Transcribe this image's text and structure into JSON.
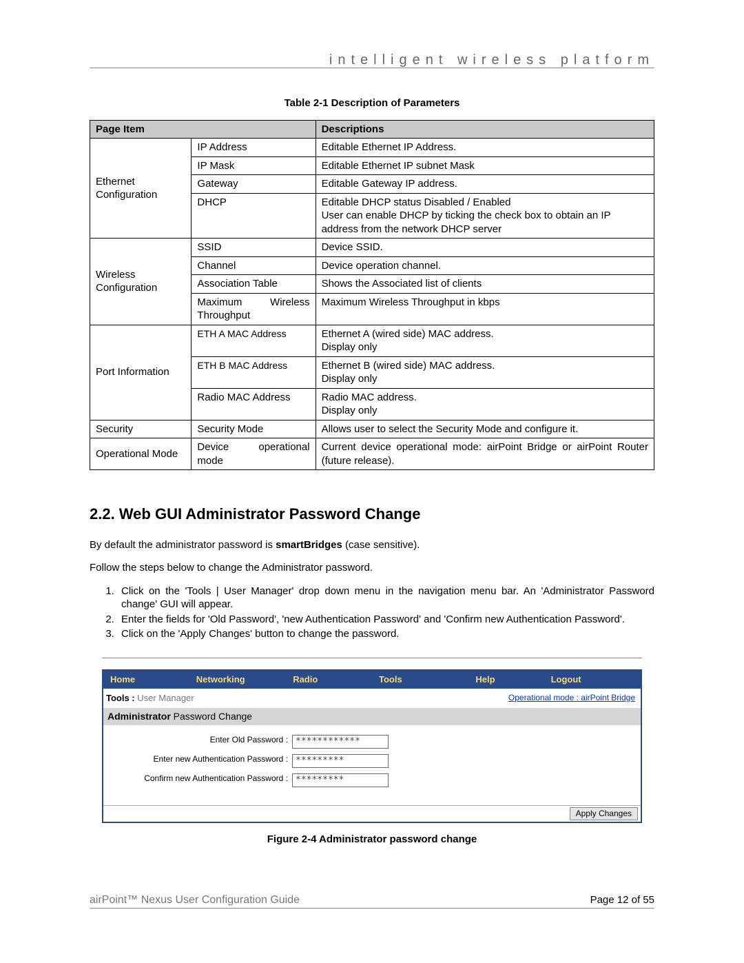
{
  "header_tagline": "intelligent wireless platform",
  "table_caption": "Table 2-1 Description of Parameters",
  "table": {
    "head": {
      "col1": "Page Item",
      "col2": "Descriptions"
    },
    "groups": [
      {
        "label": "Ethernet Configuration",
        "rows": [
          {
            "item": "IP Address",
            "desc": "Editable Ethernet IP Address."
          },
          {
            "item": "IP Mask",
            "desc": "Editable Ethernet IP subnet Mask"
          },
          {
            "item": "Gateway",
            "desc": "Editable Gateway IP address."
          },
          {
            "item": "DHCP",
            "desc": "Editable DHCP status Disabled / Enabled\nUser can enable DHCP by ticking the check box to obtain an IP address from the network DHCP server"
          }
        ]
      },
      {
        "label": "Wireless Configuration",
        "rows": [
          {
            "item": "SSID",
            "desc": "Device SSID."
          },
          {
            "item": "Channel",
            "desc": "Device operation channel."
          },
          {
            "item": "Association Table",
            "desc": "Shows the Associated list of clients"
          },
          {
            "item": "Maximum Wireless Throughput",
            "desc": "Maximum Wireless Throughput in kbps"
          }
        ]
      },
      {
        "label": "Port Information",
        "rows": [
          {
            "item": "ETH A MAC Address",
            "desc": "Ethernet A (wired side) MAC address.\nDisplay only"
          },
          {
            "item": "ETH B MAC Address",
            "desc": "Ethernet B (wired side) MAC address.\nDisplay only"
          },
          {
            "item": "Radio MAC Address",
            "desc": "Radio MAC address.\nDisplay only"
          }
        ]
      },
      {
        "label": "Security",
        "rows": [
          {
            "item": "Security Mode",
            "desc": "Allows user to select the Security Mode and configure it."
          }
        ]
      },
      {
        "label": "Operational Mode",
        "rows": [
          {
            "item": "Device operational mode",
            "desc": "Current device operational mode: airPoint Bridge or airPoint Router (future release)."
          }
        ]
      }
    ]
  },
  "section_heading": "2.2.  Web GUI Administrator Password Change",
  "para1_pre": "By default the administrator password is ",
  "para1_bold": "smartBridges",
  "para1_post": " (case sensitive).",
  "para2": "Follow the steps below to change the Administrator password.",
  "steps": [
    "Click on the 'Tools | User Manager' drop down menu in the navigation menu bar. An 'Administrator Password change' GUI will appear.",
    "Enter the fields for 'Old Password', 'new Authentication Password' and 'Confirm new Authentication Password'.",
    "Click on the 'Apply Changes' button to change the password."
  ],
  "gui": {
    "nav": [
      "Home",
      "Networking",
      "Radio",
      "Tools",
      "Help",
      "Logout"
    ],
    "sub_left_bold": "Tools :",
    "sub_left_dim": " User Manager",
    "sub_right": "Operational mode : airPoint Bridge",
    "section_adm": "Administrator",
    "section_rest": " Password Change",
    "fields": [
      {
        "label": "Enter Old Password :",
        "value": "************"
      },
      {
        "label": "Enter new Authentication Password :",
        "value": "*********"
      },
      {
        "label": "Confirm new Authentication Password :",
        "value": "*********"
      }
    ],
    "apply_label": "Apply Changes"
  },
  "figure_caption": "Figure 2-4 Administrator password change",
  "footer_left": "airPoint™ Nexus User Configuration Guide",
  "footer_right": "Page 12 of 55"
}
